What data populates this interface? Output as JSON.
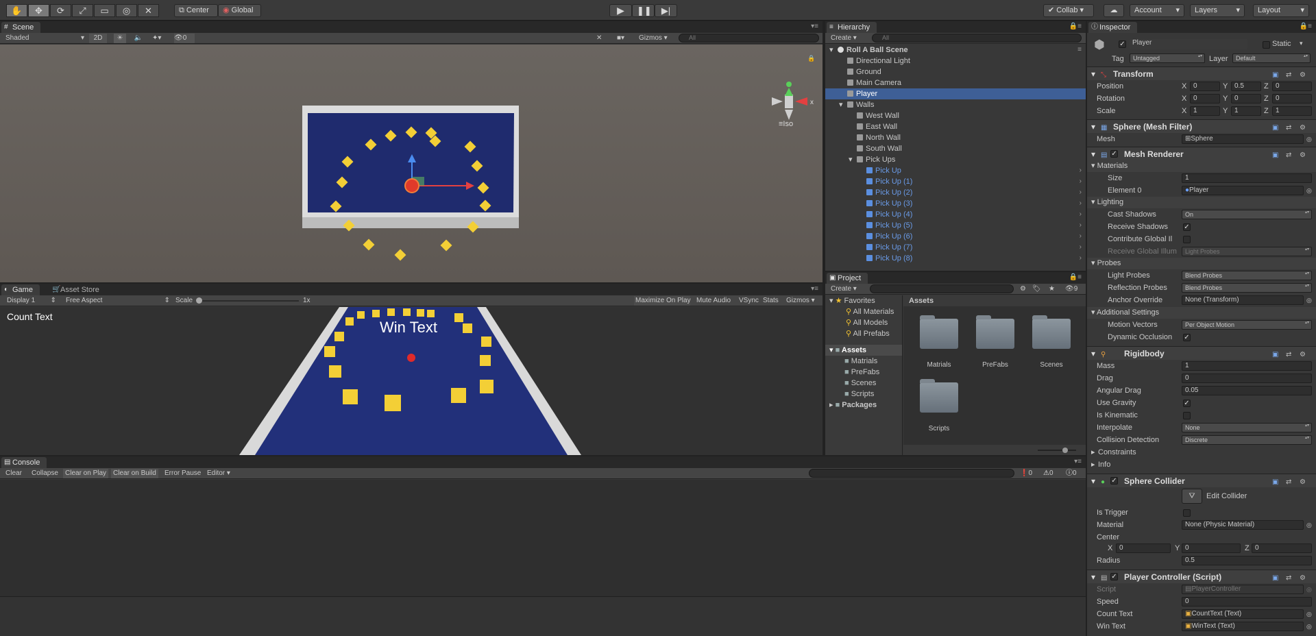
{
  "toolbar": {
    "center": "Center",
    "global": "Global",
    "collab": "Collab",
    "account": "Account",
    "layers": "Layers",
    "layout": "Layout"
  },
  "scene": {
    "tab": "Scene",
    "shading": "Shaded",
    "mode2d": "2D",
    "fx_count": "0",
    "gizmos": "Gizmos",
    "search": "All",
    "iso": "Iso"
  },
  "game": {
    "tab": "Game",
    "asset_store": "Asset Store",
    "display": "Display 1",
    "aspect": "Free Aspect",
    "scale": "Scale",
    "scale_value": "1x",
    "maximize": "Maximize On Play",
    "mute": "Mute Audio",
    "vsync": "VSync",
    "stats": "Stats",
    "gizmos": "Gizmos",
    "count_text": "Count Text",
    "win_text": "Win Text"
  },
  "hierarchy": {
    "tab": "Hierarchy",
    "create": "Create",
    "search": "All",
    "items": [
      {
        "label": "Roll A Ball Scene",
        "indent": 0,
        "style": "scene"
      },
      {
        "label": "Directional Light",
        "indent": 1,
        "style": "normal"
      },
      {
        "label": "Ground",
        "indent": 1,
        "style": "normal"
      },
      {
        "label": "Main Camera",
        "indent": 1,
        "style": "normal"
      },
      {
        "label": "Player",
        "indent": 1,
        "style": "sel"
      },
      {
        "label": "Walls",
        "indent": 1,
        "style": "parent"
      },
      {
        "label": "West Wall",
        "indent": 2,
        "style": "normal"
      },
      {
        "label": "East Wall",
        "indent": 2,
        "style": "normal"
      },
      {
        "label": "North Wall",
        "indent": 2,
        "style": "normal"
      },
      {
        "label": "South Wall",
        "indent": 2,
        "style": "normal"
      },
      {
        "label": "Pick Ups",
        "indent": 2,
        "style": "parent"
      },
      {
        "label": "Pick Up",
        "indent": 3,
        "style": "blue"
      },
      {
        "label": "Pick Up (1)",
        "indent": 3,
        "style": "blue"
      },
      {
        "label": "Pick Up (2)",
        "indent": 3,
        "style": "blue"
      },
      {
        "label": "Pick Up (3)",
        "indent": 3,
        "style": "blue"
      },
      {
        "label": "Pick Up (4)",
        "indent": 3,
        "style": "blue"
      },
      {
        "label": "Pick Up (5)",
        "indent": 3,
        "style": "blue"
      },
      {
        "label": "Pick Up (6)",
        "indent": 3,
        "style": "blue"
      },
      {
        "label": "Pick Up (7)",
        "indent": 3,
        "style": "blue"
      },
      {
        "label": "Pick Up (8)",
        "indent": 3,
        "style": "blue"
      }
    ]
  },
  "project": {
    "tab": "Project",
    "create": "Create",
    "count": "9",
    "favorites": "Favorites",
    "fav_items": [
      "All Materials",
      "All Models",
      "All Prefabs"
    ],
    "assets": "Assets",
    "asset_folders": [
      "Matrials",
      "PreFabs",
      "Scenes",
      "Scripts"
    ],
    "packages": "Packages",
    "grid_title": "Assets",
    "grid_folders": [
      "Matrials",
      "PreFabs",
      "Scenes",
      "Scripts"
    ]
  },
  "console": {
    "tab": "Console",
    "clear": "Clear",
    "collapse": "Collapse",
    "clear_on_play": "Clear on Play",
    "clear_on_build": "Clear on Build",
    "error_pause": "Error Pause",
    "editor": "Editor",
    "errors": "0",
    "warnings": "0",
    "messages": "0"
  },
  "inspector": {
    "tab": "Inspector",
    "name": "Player",
    "static": "Static",
    "tag_label": "Tag",
    "tag": "Untagged",
    "layer_label": "Layer",
    "layer": "Default",
    "transform": {
      "title": "Transform",
      "position": "Position",
      "rotation": "Rotation",
      "scale": "Scale",
      "pos": [
        "0",
        "0.5",
        "0"
      ],
      "rot": [
        "0",
        "0",
        "0"
      ],
      "scl": [
        "1",
        "1",
        "1"
      ]
    },
    "mesh_filter": {
      "title": "Sphere (Mesh Filter)",
      "mesh_label": "Mesh",
      "mesh": "Sphere"
    },
    "mesh_renderer": {
      "title": "Mesh Renderer",
      "materials": "Materials",
      "size_label": "Size",
      "size": "1",
      "element0_label": "Element 0",
      "element0": "Player",
      "lighting": "Lighting",
      "cast_shadows_label": "Cast Shadows",
      "cast_shadows": "On",
      "receive_shadows": "Receive Shadows",
      "contribute_gi": "Contribute Global Il",
      "receive_gi": "Receive Global Illum",
      "receive_gi_value": "Light Probes",
      "probes": "Probes",
      "light_probes_label": "Light Probes",
      "light_probes": "Blend Probes",
      "reflection_probes_label": "Reflection Probes",
      "reflection_probes": "Blend Probes",
      "anchor_label": "Anchor Override",
      "anchor": "None (Transform)",
      "additional": "Additional Settings",
      "motion_label": "Motion Vectors",
      "motion": "Per Object Motion",
      "dynamic_occlusion": "Dynamic Occlusion"
    },
    "rigidbody": {
      "title": "Rigidbody",
      "mass_label": "Mass",
      "mass": "1",
      "drag_label": "Drag",
      "drag": "0",
      "angular_label": "Angular Drag",
      "angular": "0.05",
      "gravity_label": "Use Gravity",
      "kinematic_label": "Is Kinematic",
      "interpolate_label": "Interpolate",
      "interpolate": "None",
      "collision_label": "Collision Detection",
      "collision": "Discrete",
      "constraints": "Constraints",
      "info": "Info"
    },
    "sphere_collider": {
      "title": "Sphere Collider",
      "edit": "Edit Collider",
      "trigger_label": "Is Trigger",
      "material_label": "Material",
      "material": "None (Physic Material)",
      "center_label": "Center",
      "center": [
        "0",
        "0",
        "0"
      ],
      "radius_label": "Radius",
      "radius": "0.5"
    },
    "player_controller": {
      "title": "Player Controller (Script)",
      "script_label": "Script",
      "script": "PlayerController",
      "speed_label": "Speed",
      "speed": "0",
      "count_label": "Count Text",
      "count": "CountText (Text)",
      "win_label": "Win Text",
      "win": "WinText (Text)"
    }
  }
}
